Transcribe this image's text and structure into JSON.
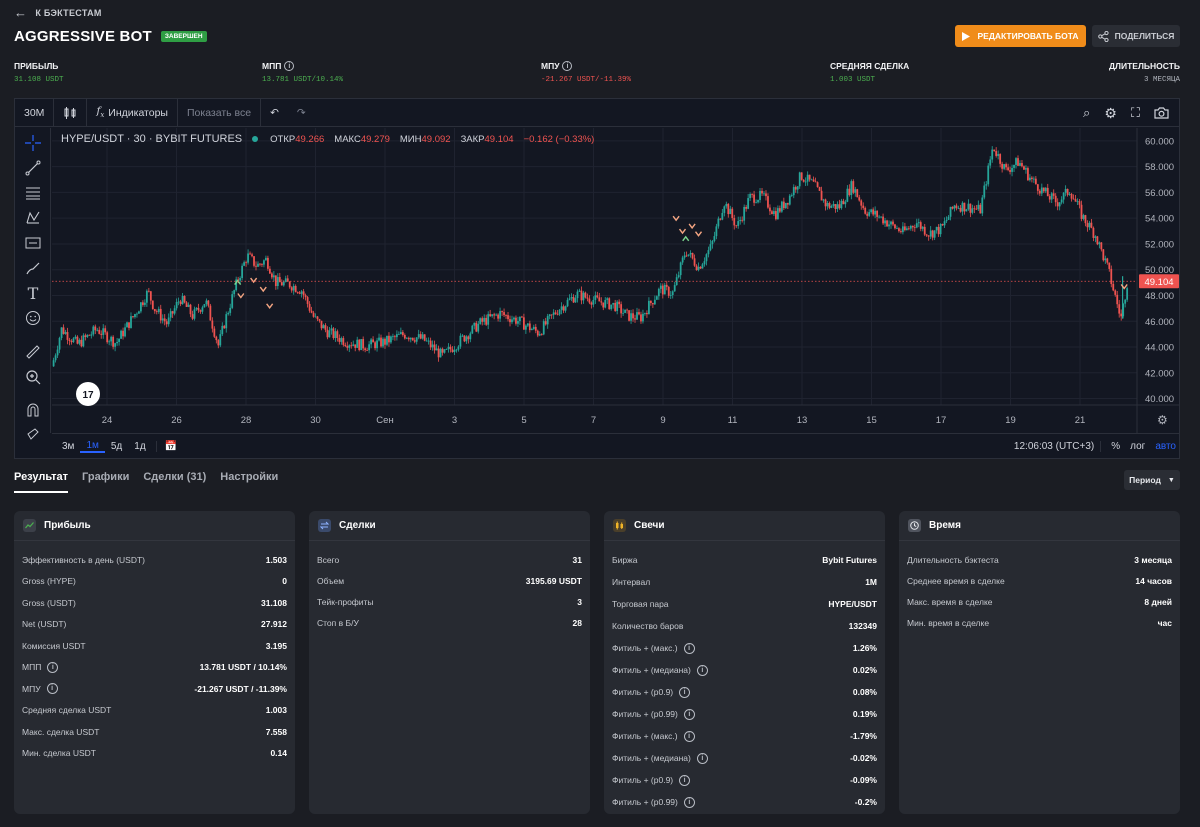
{
  "header": {
    "back_label": "К БЭКТЕСТАМ",
    "title": "AGGRESSIVE BOT",
    "status_badge": "ЗАВЕРШЕН",
    "edit_button": "РЕДАКТИРОВАТЬ БОТА",
    "share_button": "ПОДЕЛИТЬСЯ"
  },
  "stats": {
    "profit": {
      "label": "ПРИБЫЛЬ",
      "value": "31.108 USDT"
    },
    "mpp": {
      "label": "МПП",
      "value": "13.781 USDT/10.14%"
    },
    "mpu": {
      "label": "МПУ",
      "value": "-21.267 USDT/-11.39%"
    },
    "avg_trade": {
      "label": "СРЕДНЯЯ СДЕЛКА",
      "value": "1.003 USDT"
    },
    "duration": {
      "label": "ДЛИТЕЛЬНОСТЬ",
      "value": "3 МЕСЯЦА"
    }
  },
  "chart_toolbar": {
    "interval": "30M",
    "indicators": "Индикаторы",
    "show_all": "Показать все"
  },
  "chart_legend": {
    "symbol": "HYPE/USDT · 30 · BYBIT FUTURES",
    "open_label": "ОТКР",
    "open": "49.266",
    "high_label": "МАКС",
    "high": "49.279",
    "low_label": "МИН",
    "low": "49.092",
    "close_label": "ЗАКР",
    "close": "49.104",
    "change": "−0.162 (−0.33%)"
  },
  "chart_bottom": {
    "timeframes": [
      "3м",
      "1м",
      "5д",
      "1д"
    ],
    "active_timeframe": "1м",
    "clock": "12:06:03 (UTC+3)",
    "percent": "%",
    "log": "лог",
    "auto": "авто"
  },
  "chart_data": {
    "type": "candlestick",
    "x_ticks": [
      "24",
      "26",
      "28",
      "30",
      "Сен",
      "3",
      "5",
      "7",
      "9",
      "11",
      "13",
      "15",
      "17",
      "19",
      "21"
    ],
    "y_ticks": [
      "60.000",
      "58.000",
      "56.000",
      "54.000",
      "52.000",
      "50.000",
      "48.000",
      "46.000",
      "44.000",
      "42.000",
      "40.000"
    ],
    "ylim": [
      39.5,
      61
    ],
    "last_price": "49.104",
    "price_path": [
      [
        0,
        42.5
      ],
      [
        3,
        45.4
      ],
      [
        8,
        44.2
      ],
      [
        14,
        45.4
      ],
      [
        20,
        44.3
      ],
      [
        26,
        46.6
      ],
      [
        30,
        48.3
      ],
      [
        32,
        47.0
      ],
      [
        36,
        45.8
      ],
      [
        40,
        47.8
      ],
      [
        44,
        46.4
      ],
      [
        48,
        47.6
      ],
      [
        52,
        44.1
      ],
      [
        54,
        46.0
      ],
      [
        58,
        49.2
      ],
      [
        61,
        51.1
      ],
      [
        64,
        50.3
      ],
      [
        67,
        50.8
      ],
      [
        70,
        49.0
      ],
      [
        74,
        48.9
      ],
      [
        78,
        48.4
      ],
      [
        82,
        46.2
      ],
      [
        86,
        45.2
      ],
      [
        92,
        44.4
      ],
      [
        98,
        44.1
      ],
      [
        104,
        44.4
      ],
      [
        110,
        45.0
      ],
      [
        116,
        44.6
      ],
      [
        122,
        43.3
      ],
      [
        128,
        44.6
      ],
      [
        134,
        45.9
      ],
      [
        140,
        46.6
      ],
      [
        146,
        46.0
      ],
      [
        152,
        45.1
      ],
      [
        158,
        46.9
      ],
      [
        164,
        48.1
      ],
      [
        170,
        47.6
      ],
      [
        176,
        47.2
      ],
      [
        180,
        46.4
      ],
      [
        184,
        46.3
      ],
      [
        190,
        48.5
      ],
      [
        194,
        48.2
      ],
      [
        198,
        51.5
      ],
      [
        202,
        50.2
      ],
      [
        206,
        51.8
      ],
      [
        210,
        55.3
      ],
      [
        214,
        53.3
      ],
      [
        218,
        55.6
      ],
      [
        222,
        55.7
      ],
      [
        226,
        54.3
      ],
      [
        230,
        55.5
      ],
      [
        234,
        57.3
      ],
      [
        238,
        56.6
      ],
      [
        242,
        55.0
      ],
      [
        246,
        54.9
      ],
      [
        250,
        56.6
      ],
      [
        254,
        54.6
      ],
      [
        258,
        54.2
      ],
      [
        262,
        53.5
      ],
      [
        266,
        52.9
      ],
      [
        270,
        53.7
      ],
      [
        274,
        52.8
      ],
      [
        278,
        53.2
      ],
      [
        282,
        55.0
      ],
      [
        286,
        54.9
      ],
      [
        290,
        54.6
      ],
      [
        294,
        59.6
      ],
      [
        298,
        57.7
      ],
      [
        302,
        58.4
      ],
      [
        306,
        57.0
      ],
      [
        310,
        56.0
      ],
      [
        314,
        55.2
      ],
      [
        318,
        56.2
      ],
      [
        322,
        54.1
      ],
      [
        326,
        52.7
      ],
      [
        330,
        50.0
      ],
      [
        334,
        46.2
      ],
      [
        336,
        49.1
      ]
    ],
    "current_price": 49.104
  },
  "tabs": {
    "items": [
      "Результат",
      "Графики",
      "Сделки (31)",
      "Настройки"
    ],
    "active": "Результат",
    "period_button": "Период"
  },
  "cards": {
    "profit": {
      "title": "Прибыль",
      "rows": [
        {
          "k": "Эффективность в день (USDT)",
          "v": "1.503"
        },
        {
          "k": "Gross (HYPE)",
          "v": "0"
        },
        {
          "k": "Gross (USDT)",
          "v": "31.108"
        },
        {
          "k": "Net (USDT)",
          "v": "27.912"
        },
        {
          "k": "Комиссия USDT",
          "v": "3.195"
        },
        {
          "k": "МПП",
          "v": "13.781 USDT / 10.14%",
          "info": true
        },
        {
          "k": "МПУ",
          "v": "-21.267 USDT / -11.39%",
          "info": true
        },
        {
          "k": "Средняя сделка USDT",
          "v": "1.003"
        },
        {
          "k": "Макс. сделка USDT",
          "v": "7.558"
        },
        {
          "k": "Мин. сделка USDT",
          "v": "0.14"
        }
      ]
    },
    "trades": {
      "title": "Сделки",
      "rows": [
        {
          "k": "Всего",
          "v": "31"
        },
        {
          "k": "Объем",
          "v": "3195.69 USDT"
        },
        {
          "k": "Тейк-профиты",
          "v": "3"
        },
        {
          "k": "Стоп в Б/У",
          "v": "28"
        }
      ]
    },
    "candles": {
      "title": "Свечи",
      "rows": [
        {
          "k": "Биржа",
          "v": "Bybit Futures"
        },
        {
          "k": "Интервал",
          "v": "1M"
        },
        {
          "k": "Торговая пара",
          "v": "HYPE/USDT"
        },
        {
          "k": "Количество баров",
          "v": "132349"
        },
        {
          "k": "Фитиль + (макс.)",
          "v": "1.26%",
          "info": true
        },
        {
          "k": "Фитиль + (медиана)",
          "v": "0.02%",
          "info": true
        },
        {
          "k": "Фитиль + (p0.9)",
          "v": "0.08%",
          "info": true
        },
        {
          "k": "Фитиль + (p0.99)",
          "v": "0.19%",
          "info": true
        },
        {
          "k": "Фитиль + (макс.)",
          "v": "-1.79%",
          "info": true
        },
        {
          "k": "Фитиль + (медиана)",
          "v": "-0.02%",
          "info": true
        },
        {
          "k": "Фитиль + (p0.9)",
          "v": "-0.09%",
          "info": true
        },
        {
          "k": "Фитиль + (p0.99)",
          "v": "-0.2%",
          "info": true
        }
      ]
    },
    "time": {
      "title": "Время",
      "rows": [
        {
          "k": "Длительность бэктеста",
          "v": "3 месяца"
        },
        {
          "k": "Среднее время в сделке",
          "v": "14 часов"
        },
        {
          "k": "Макс. время в сделке",
          "v": "8 дней"
        },
        {
          "k": "Мин. время в сделке",
          "v": "час"
        }
      ]
    }
  },
  "colors": {
    "accent": "#f08c1a",
    "up": "#26a69a",
    "down": "#ef5350",
    "badge": "#2f9e44",
    "tv_blue": "#2962ff"
  }
}
